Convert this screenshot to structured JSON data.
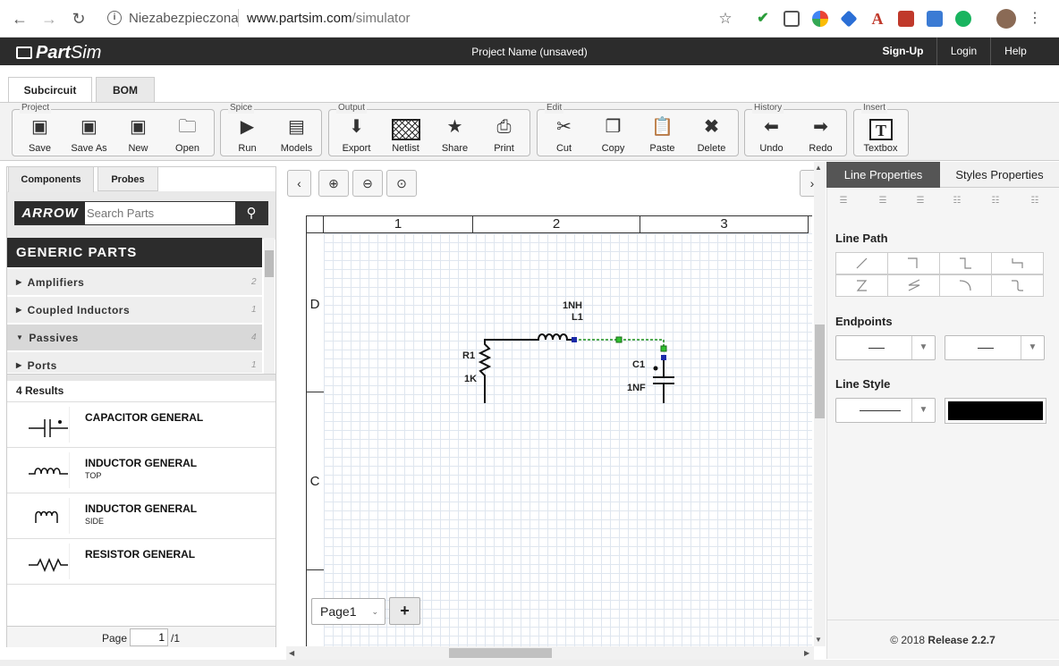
{
  "browser": {
    "security_label": "Niezabezpieczona",
    "url_host": "www.partsim.com",
    "url_path": "/simulator"
  },
  "header": {
    "logo_bold": "Part",
    "logo_light": "Sim",
    "project_name": "Project Name (unsaved)",
    "signup": "Sign-Up",
    "login": "Login",
    "help": "Help"
  },
  "top_tabs": [
    "Subcircuit",
    "BOM"
  ],
  "toolbar": {
    "groups": [
      "Project",
      "Spice",
      "Output",
      "Edit",
      "History",
      "Insert"
    ],
    "tools": [
      "Save",
      "Save As",
      "New",
      "Open",
      "Run",
      "Models",
      "Export",
      "Netlist",
      "Share",
      "Print",
      "Cut",
      "Copy",
      "Paste",
      "Delete",
      "Undo",
      "Redo",
      "Textbox"
    ]
  },
  "left_panel": {
    "tabs": [
      "Components",
      "Probes"
    ],
    "brand": "ARROW",
    "search_placeholder": "Search Parts",
    "parts_header": "GENERIC PARTS",
    "categories": [
      {
        "label": "Amplifiers",
        "count": "2",
        "expanded": false
      },
      {
        "label": "Coupled Inductors",
        "count": "1",
        "expanded": false
      },
      {
        "label": "Passives",
        "count": "4",
        "expanded": true
      },
      {
        "label": "Ports",
        "count": "1",
        "expanded": false
      }
    ],
    "results_count": "4 Results",
    "results": [
      {
        "name": "CAPACITOR GENERAL",
        "sub": ""
      },
      {
        "name": "INDUCTOR GENERAL",
        "sub": "TOP"
      },
      {
        "name": "INDUCTOR GENERAL",
        "sub": "SIDE"
      },
      {
        "name": "RESISTOR GENERAL",
        "sub": ""
      }
    ],
    "pager": {
      "label": "Page",
      "current": "1",
      "total": "/1"
    }
  },
  "canvas": {
    "columns": [
      "1",
      "2",
      "3"
    ],
    "rows": [
      "D",
      "C"
    ],
    "components": {
      "r1_ref": "R1",
      "r1_val": "1K",
      "l1_val": "1NH",
      "l1_ref": "L1",
      "c1_ref": "C1",
      "c1_val": "1NF"
    },
    "page_tab": "Page1",
    "add_page": "+"
  },
  "right_panel": {
    "tabs": [
      "Line Properties",
      "Styles Properties"
    ],
    "line_path": "Line Path",
    "endpoints": "Endpoints",
    "line_style": "Line Style",
    "color": "#000000",
    "copyright_prefix": "© 2018",
    "release": "Release 2.2.7"
  }
}
